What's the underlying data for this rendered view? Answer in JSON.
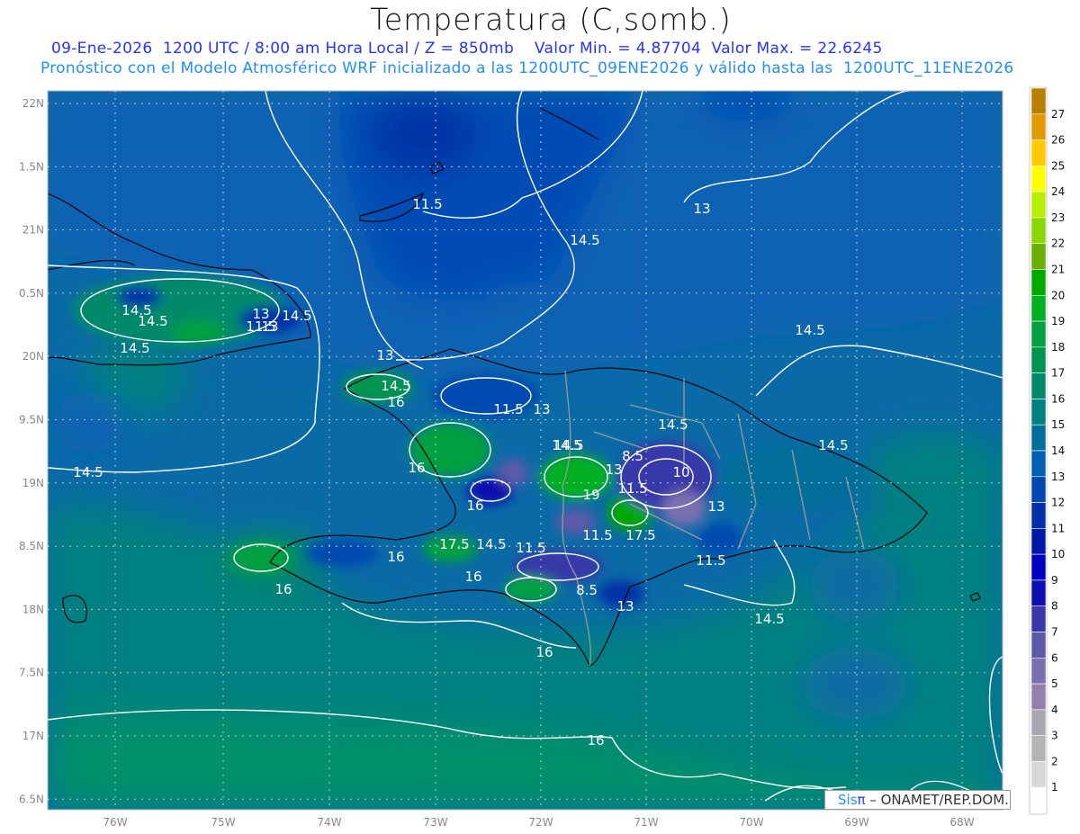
{
  "header": {
    "title": "Temperatura (C,somb.)",
    "subtitle_line1": "09-Ene-2026  1200 UTC / 8:00 am Hora Local / Z = 850mb    Valor Min. = 4.87704  Valor Max. = 22.6245",
    "subtitle_line2": "Pronóstico con el Modelo Atmosférico WRF inicializado a las 1200UTC_09ENE2026 y válido hasta las  1200UTC_11ENE2026"
  },
  "map": {
    "variable": "Temperature 850mb",
    "lon_labels": [
      "76W",
      "75W",
      "74W",
      "73W",
      "72W",
      "71W",
      "70W",
      "69W",
      "68W"
    ],
    "lat_labels": [
      "22N",
      "1.5N",
      "21N",
      "0.5N",
      "20N",
      "9.5N",
      "19N",
      "8.5N",
      "18N",
      "7.5N",
      "17N",
      "6.5N"
    ],
    "contour_labels": [
      "11.5",
      "13",
      "14.5",
      "14.5",
      "13",
      "14.5",
      "14.5",
      "13",
      "11.5",
      "14.5",
      "14.5",
      "14.5",
      "13",
      "14.5",
      "16",
      "11.5",
      "13",
      "14.5",
      "14.5",
      "16",
      "8.5",
      "13",
      "10",
      "11.5",
      "16",
      "19",
      "13",
      "11.5",
      "17.5",
      "14.5",
      "16",
      "17.5",
      "14.5",
      "11.5",
      "11.5",
      "16",
      "16",
      "8.5",
      "13",
      "14.5",
      "16",
      "16",
      "14.5"
    ],
    "coast_color": "#000000",
    "border_color": "#999999",
    "contour_color": "#ffffff"
  },
  "colorbar": {
    "labels": [
      "27",
      "26",
      "25",
      "24",
      "23",
      "22",
      "21",
      "20",
      "19",
      "18",
      "17",
      "16",
      "15",
      "14",
      "13",
      "12",
      "11",
      "10",
      "9",
      "8",
      "7",
      "6",
      "5",
      "4",
      "3",
      "2",
      "1"
    ],
    "colors": [
      "#b87f00",
      "#e09a00",
      "#ffc800",
      "#ffff00",
      "#b4f000",
      "#8cd600",
      "#6aae00",
      "#00a800",
      "#00b020",
      "#00a040",
      "#009450",
      "#008a6a",
      "#008080",
      "#006e98",
      "#0060b4",
      "#0048b0",
      "#0030a8",
      "#0018a8",
      "#0000c0",
      "#1010b0",
      "#3838a8",
      "#5c5aa8",
      "#7a70b0",
      "#9480b0",
      "#a8a8b0",
      "#b4b4b4",
      "#d8d8d8",
      "#ffffff"
    ]
  },
  "credit": {
    "brand_sis": "Sis",
    "brand_pi": "π",
    "text": " – ONAMET/REP.DOM."
  }
}
